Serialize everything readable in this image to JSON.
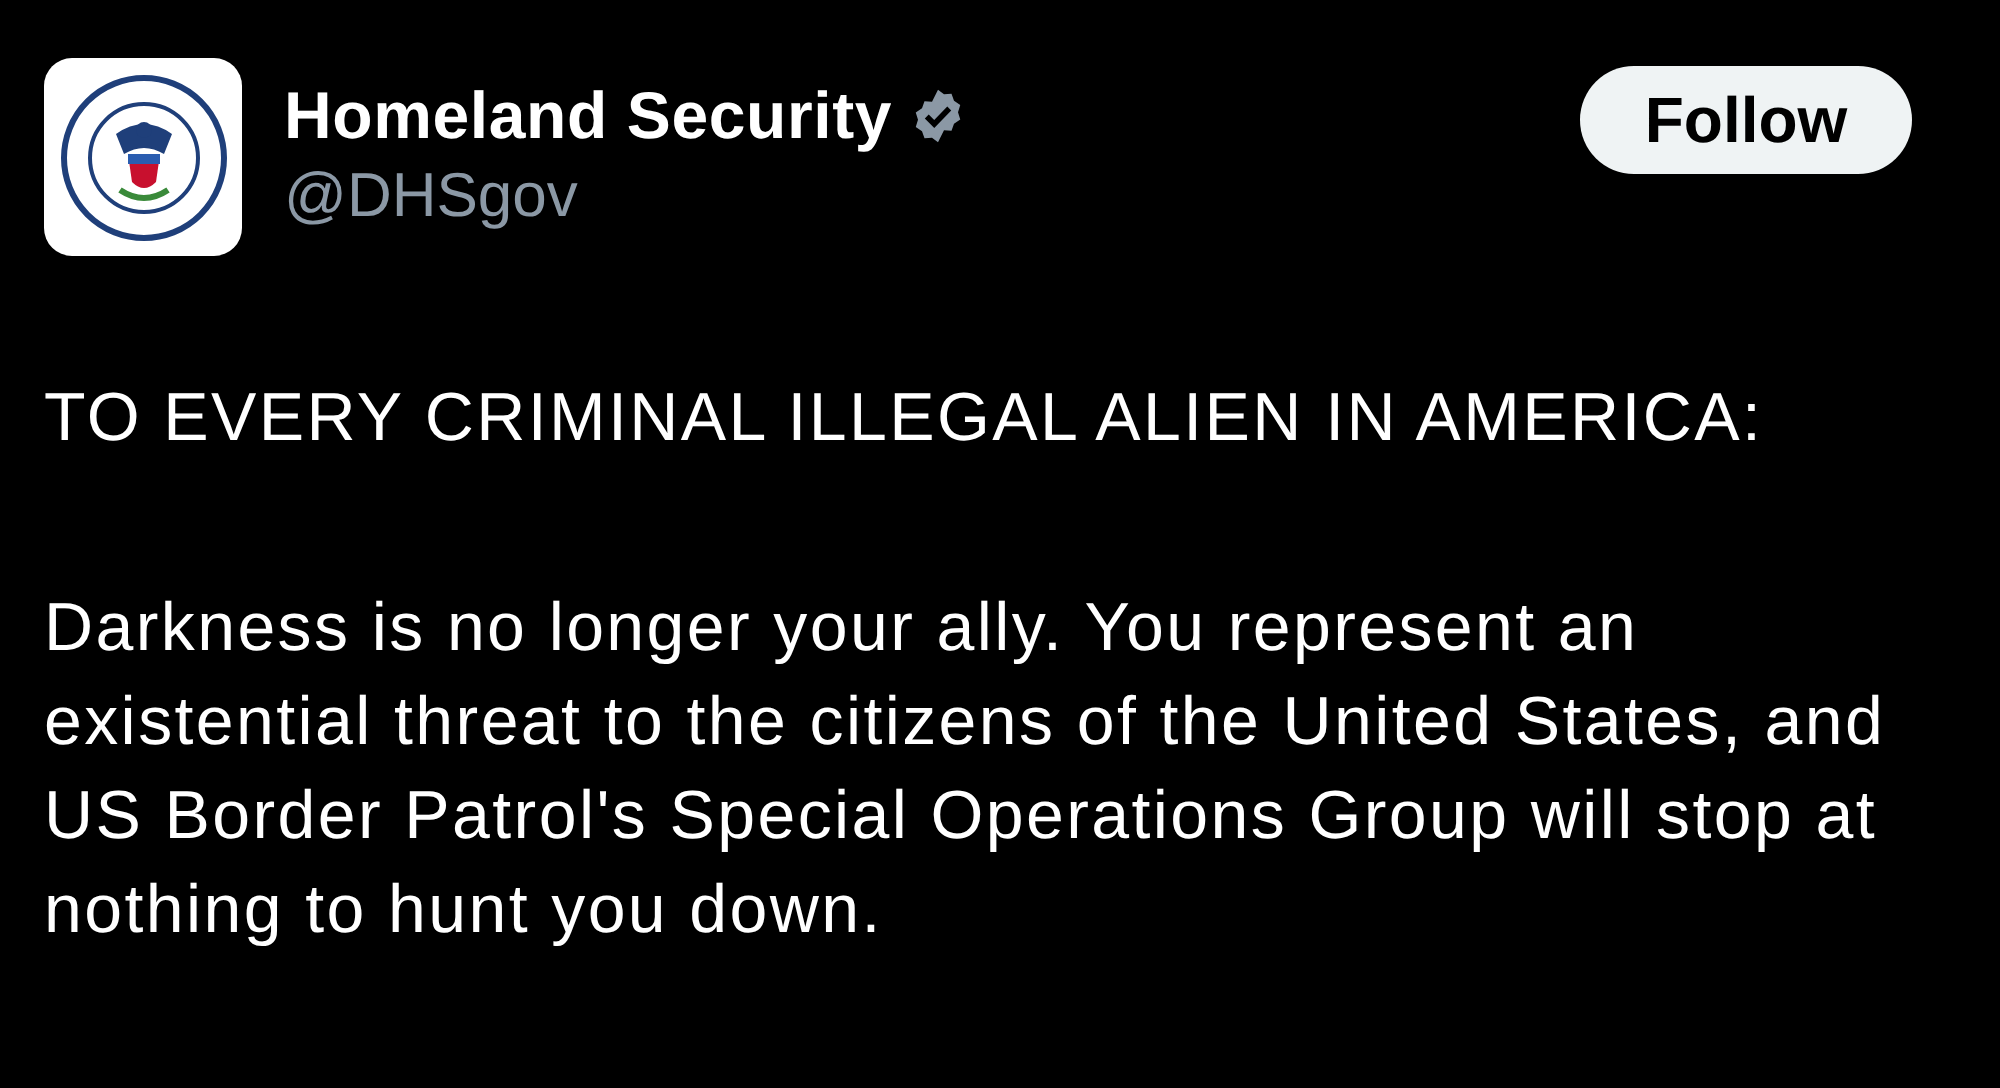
{
  "post": {
    "author": {
      "name": "Homeland Security",
      "verified": true,
      "handle": "@DHSgov"
    },
    "follow_button": "Follow",
    "paragraphs": [
      "TO EVERY CRIMINAL ILLEGAL ALIEN IN AMERICA:",
      "Darkness is no longer your ally. You represent an existential threat to the citizens of the United States, and US Border Patrol's Special Operations Group will stop at nothing to hunt you down."
    ]
  }
}
